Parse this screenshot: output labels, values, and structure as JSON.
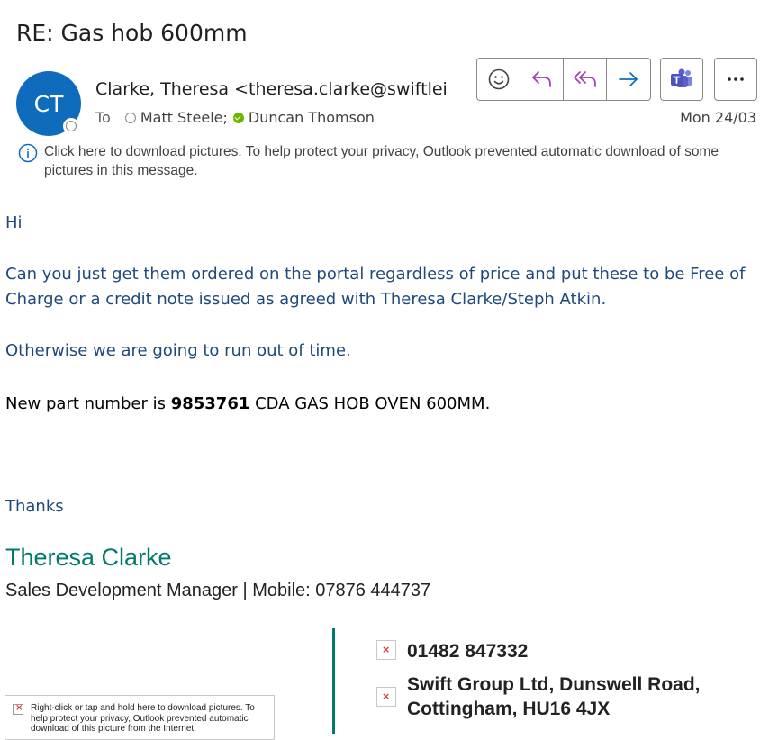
{
  "header": {
    "subject": "RE: Gas hob 600mm",
    "avatar_initials": "CT",
    "from": "Clarke, Theresa <theresa.clarke@swiftleisure.co.uk>",
    "to_label": "To",
    "recipients": [
      "Matt Steele;",
      "Duncan Thomson"
    ],
    "date": "Mon 24/03"
  },
  "toolbar": {
    "buttons": [
      "smiley-icon",
      "reply-icon",
      "reply-all-icon",
      "forward-icon",
      "teams-icon",
      "more-icon"
    ]
  },
  "info_bar": {
    "text": "Click here to download pictures. To help protect your privacy, Outlook prevented automatic download of some pictures in this message."
  },
  "body": {
    "greeting": "Hi",
    "para1": "Can you just get them ordered on the portal regardless of price and put these to be Free of Charge or a credit note issued as agreed with Theresa Clarke/Steph Atkin.",
    "para2": "Otherwise we are going to run out of time.",
    "part_prefix": "New part number is ",
    "part_number": "9853761",
    "part_suffix": " CDA GAS HOB OVEN 600MM.",
    "closing": "Thanks"
  },
  "signature": {
    "name": "Theresa Clarke",
    "title": "Sales Development Manager | Mobile: 07876 444737",
    "phone": "01482 847332",
    "address": "Swift Group Ltd, Dunswell Road, Cottingham, HU16 4JX",
    "blocked_image_text": "Right-click or tap and hold here to download pictures. To help protect your privacy, Outlook prevented automatic download of this picture from the Internet."
  },
  "colors": {
    "avatar_bg": "#0f6cbd",
    "body_text": "#1f497d",
    "signature_accent": "#007a6c",
    "teams_purple": "#5b5fc7",
    "reply_purple": "#a23bb8",
    "forward_blue": "#0f6cbd"
  }
}
